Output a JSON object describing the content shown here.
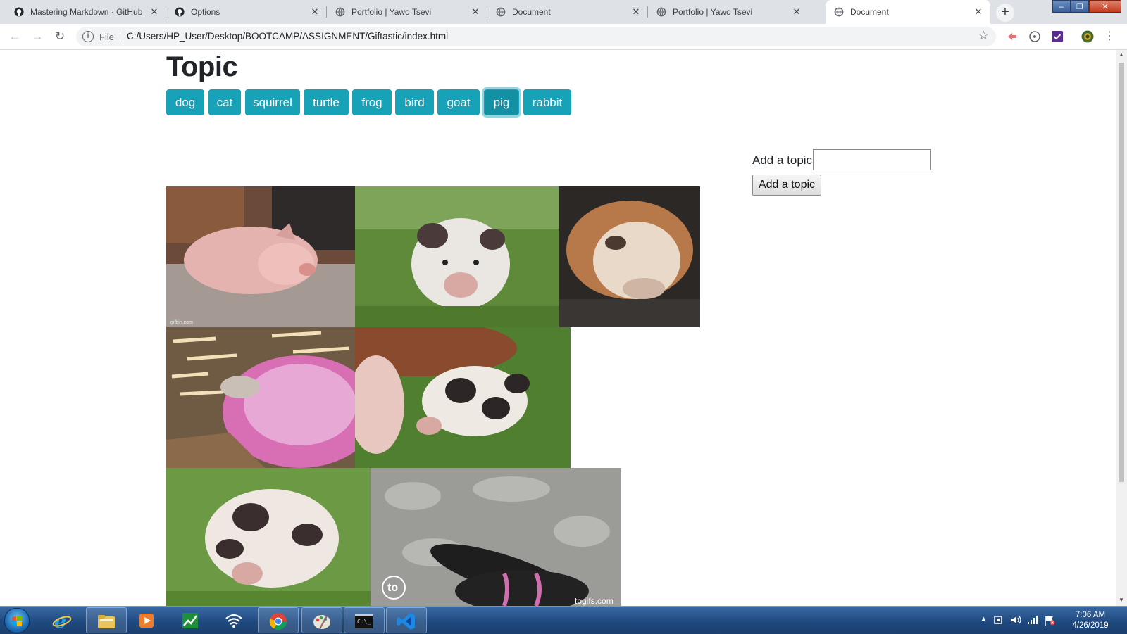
{
  "browser": {
    "tabs": [
      {
        "title": "Mastering Markdown · GitHub Guides",
        "icon": "github-icon",
        "active": false
      },
      {
        "title": "Options",
        "icon": "github-icon",
        "active": false
      },
      {
        "title": "Portfolio | Yawo Tsevi",
        "icon": "globe-icon",
        "active": false
      },
      {
        "title": "Document",
        "icon": "globe-icon",
        "active": false
      },
      {
        "title": "Portfolio | Yawo Tsevi",
        "icon": "globe-icon",
        "active": false
      },
      {
        "title": "Document",
        "icon": "globe-icon",
        "active": true
      }
    ],
    "close_glyph": "✕",
    "new_tab_glyph": "+",
    "address": {
      "scheme_label": "File",
      "url": "C:/Users/HP_User/Desktop/BOOTCAMP/ASSIGNMENT/Giftastic/index.html"
    }
  },
  "page": {
    "title": "Topic",
    "topics": [
      "dog",
      "cat",
      "squirrel",
      "turtle",
      "frog",
      "bird",
      "goat",
      "pig",
      "rabbit"
    ],
    "selected_topic": "pig",
    "form": {
      "label": "Add a topic",
      "input_value": "",
      "button_label": "Add a topic"
    },
    "gifs": [
      {
        "subject": "pink pig lying on carpet",
        "watermark": "gifbin.com"
      },
      {
        "subject": "spotted piglet on grass",
        "watermark": ""
      },
      {
        "subject": "piglet sleeping in blanket",
        "watermark": ""
      },
      {
        "subject": "piglet drinking from pink tub",
        "watermark": ""
      },
      {
        "subject": "spotted piglets grazing",
        "watermark": ""
      },
      {
        "subject": "spotted piglet standing on grass",
        "watermark": ""
      },
      {
        "subject": "piglet in harness on skateboard",
        "watermark": "togifs.com"
      }
    ]
  },
  "taskbar": {
    "apps": [
      "internet-explorer",
      "file-explorer",
      "media-player",
      "stock-app",
      "network-app",
      "chrome",
      "paint",
      "command-prompt",
      "visual-studio-code"
    ],
    "clock": {
      "time": "7:06 AM",
      "date": "4/26/2019"
    }
  },
  "colors": {
    "topic_button": "#17a2b8",
    "tab_strip": "#dee1e6"
  }
}
